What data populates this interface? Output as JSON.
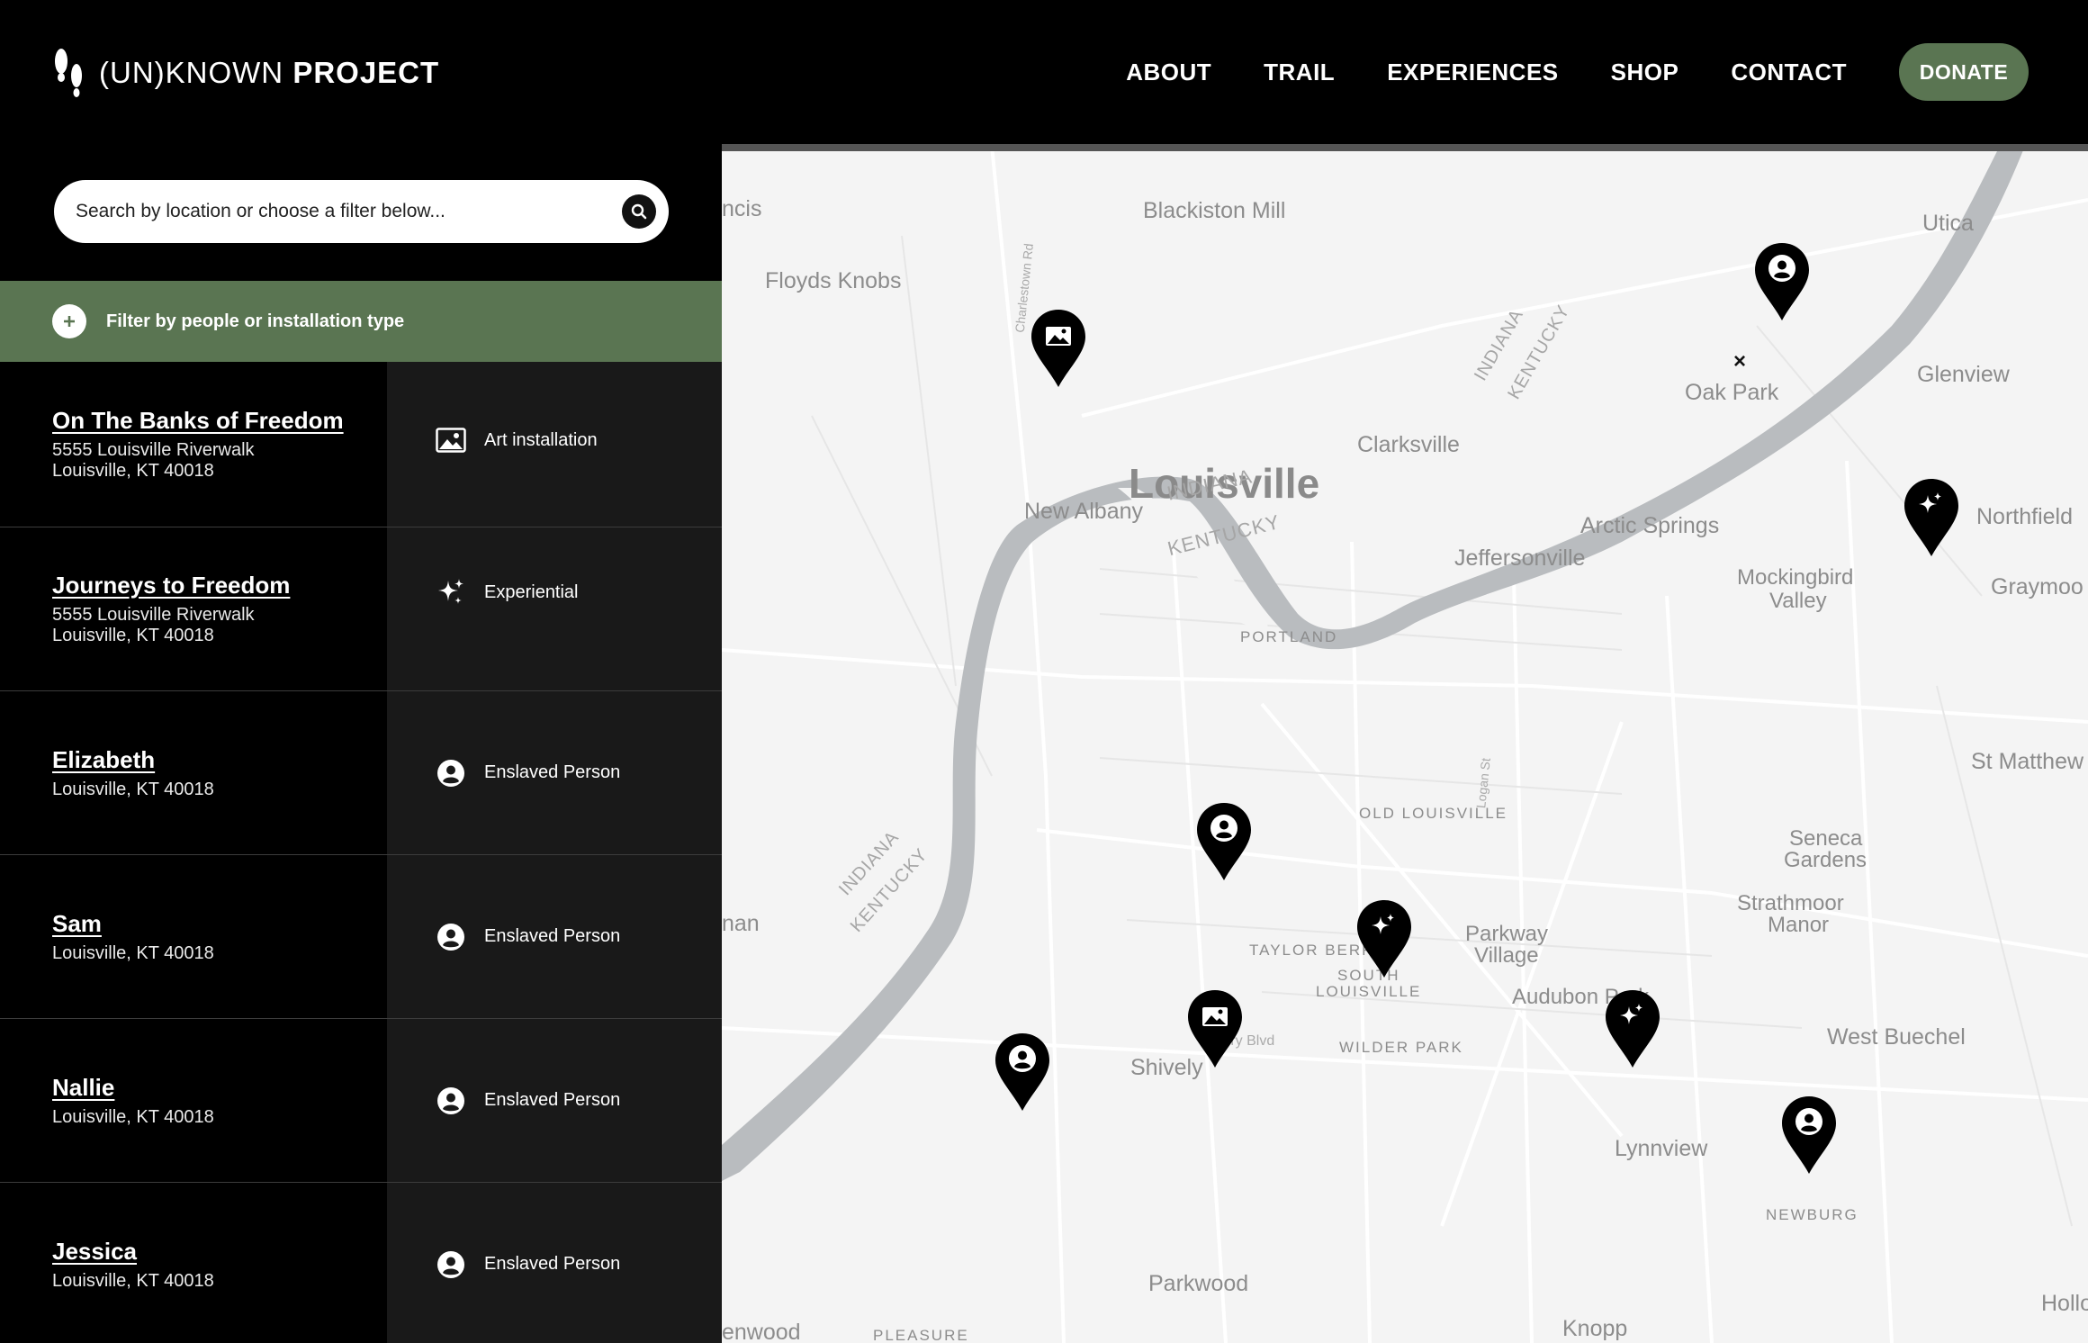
{
  "header": {
    "logo_light": "(UN)KNOWN",
    "logo_bold": "PROJECT",
    "nav": [
      "ABOUT",
      "TRAIL",
      "EXPERIENCES",
      "SHOP",
      "CONTACT"
    ],
    "donate_label": "DONATE"
  },
  "search": {
    "placeholder": "Search by location or choose a filter below..."
  },
  "filter": {
    "label": "Filter by people or installation type"
  },
  "locations": [
    {
      "title": "On The Banks of Freedom",
      "address1": "5555 Louisville Riverwalk",
      "address2": "Louisville, KT 40018",
      "type": "Art installation",
      "icon": "image-icon"
    },
    {
      "title": "Journeys to Freedom",
      "address1": "5555 Louisville Riverwalk",
      "address2": "Louisville, KT 40018",
      "type": "Experiential",
      "icon": "sparkle-icon"
    },
    {
      "title": "Elizabeth",
      "address1": "Louisville, KT 40018",
      "address2": "",
      "type": "Enslaved Person",
      "icon": "person-icon"
    },
    {
      "title": "Sam",
      "address1": "Louisville, KT 40018",
      "address2": "",
      "type": "Enslaved Person",
      "icon": "person-icon"
    },
    {
      "title": "Nallie",
      "address1": "Louisville, KT 40018",
      "address2": "",
      "type": "Enslaved Person",
      "icon": "person-icon"
    },
    {
      "title": "Jessica",
      "address1": "Louisville, KT 40018",
      "address2": "",
      "type": "Enslaved Person",
      "icon": "person-icon"
    }
  ],
  "map": {
    "labels": {
      "city": "Louisville",
      "blackiston": "Blackiston Mill",
      "floyds": "Floyds Knobs",
      "utica": "Utica",
      "oakpark": "Oak Park",
      "glenview": "Glenview",
      "clarksville": "Clarksville",
      "newalbany": "New Albany",
      "northfield": "Northfield",
      "arctic": "Arctic Springs",
      "jeffersonville": "Jeffersonville",
      "mockingbird1": "Mockingbird",
      "mockingbird2": "Valley",
      "graymoor": "Graymoo",
      "portland": "PORTLAND",
      "stmatthews": "St Matthew",
      "oldlouisville": "OLD LOUISVILLE",
      "seneca1": "Seneca",
      "seneca2": "Gardens",
      "strathmoor1": "Strathmoor",
      "strathmoor2": "Manor",
      "parkway1": "Parkway",
      "parkway2": "Village",
      "taylorberry": "TAYLOR BERRY",
      "southlou1": "SOUTH",
      "southlou2": "LOUISVILLE",
      "audubon": "Audubon Park",
      "westbuechel": "West Buechel",
      "wilderpark": "WILDER PARK",
      "shively": "Shively",
      "lynnview": "Lynnview",
      "newburg": "NEWBURG",
      "parkwood": "Parkwood",
      "knopp": "Knopp",
      "holloway": "Hollo",
      "pleasure": "PLEASURE",
      "wood": "enwood",
      "cis": "ncis",
      "nan": "nan",
      "indiana1": "INDIANA",
      "kentucky1": "KENTUCKY",
      "indiana2": "INDIANA",
      "kentucky2": "KENTUCKY",
      "indiana3": "INDIANA",
      "kentucky3": "KENTUCKY",
      "charlestown": "Charlestown Rd",
      "logan": "Logan St",
      "dixie": "rry Blvd"
    },
    "close_label": "×",
    "pins": [
      {
        "type": "image"
      },
      {
        "type": "person"
      },
      {
        "type": "sparkle"
      },
      {
        "type": "person"
      },
      {
        "type": "sparkle"
      },
      {
        "type": "image"
      },
      {
        "type": "person"
      },
      {
        "type": "sparkle"
      },
      {
        "type": "person"
      }
    ]
  },
  "colors": {
    "accent_green": "#5a7552",
    "river": "#b9bcbf",
    "map_bg": "#f4f4f4"
  }
}
